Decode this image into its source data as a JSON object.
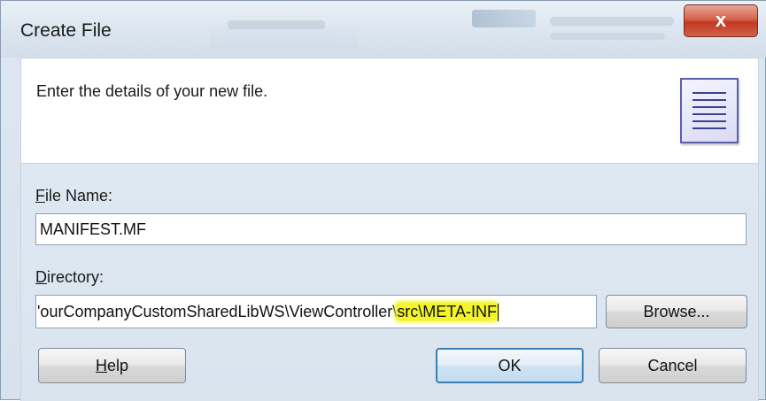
{
  "window": {
    "title": "Create File",
    "close_label": "x"
  },
  "header": {
    "message": "Enter the details of your new file.",
    "icon": "document-lines-icon"
  },
  "form": {
    "file_name": {
      "label_mnemonic": "F",
      "label_rest": "ile Name:",
      "value": "MANIFEST.MF"
    },
    "directory": {
      "label_mnemonic": "D",
      "label_rest": "irectory:",
      "value_prefix": "'ourCompanyCustomSharedLibWS\\ViewController\\",
      "value_highlighted": "src\\META-INF",
      "browse_label": "Browse..."
    }
  },
  "buttons": {
    "help_mnemonic": "H",
    "help_rest": "elp",
    "ok_label": "OK",
    "cancel_label": "Cancel"
  },
  "colors": {
    "highlight": "#f3f52a",
    "close_button": "#c13a23",
    "default_button_border": "#3c7fb1"
  }
}
